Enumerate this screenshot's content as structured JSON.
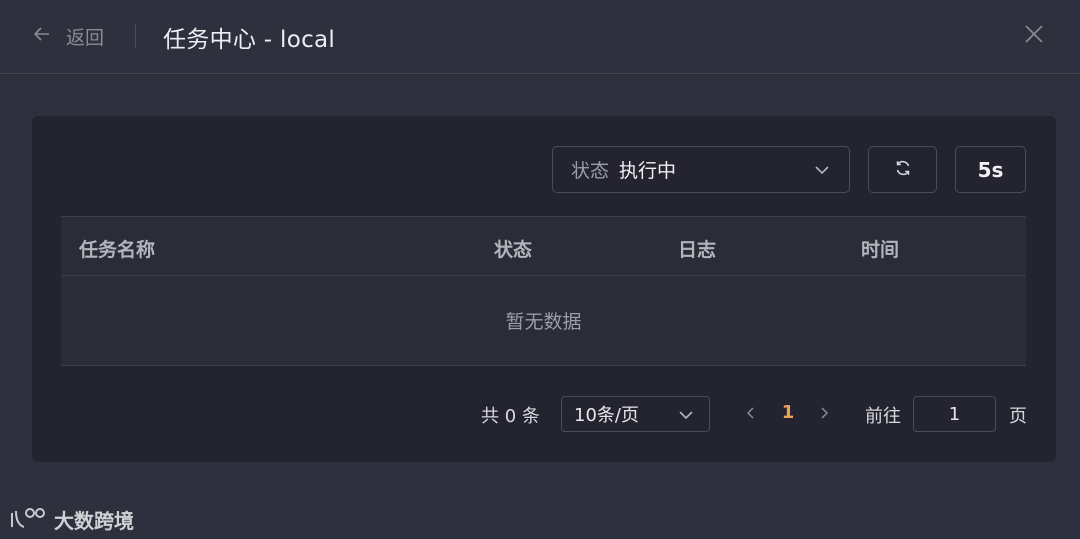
{
  "header": {
    "back_label": "返回",
    "title": "任务中心 - local"
  },
  "filters": {
    "status_prefix": "状态",
    "status_value": "执行中",
    "interval_label": "5s"
  },
  "table": {
    "columns": [
      "任务名称",
      "状态",
      "日志",
      "时间"
    ],
    "rows": [],
    "empty_text": "暂无数据"
  },
  "pagination": {
    "total_text": "共 0 条",
    "page_size": "10条/页",
    "current_page": "1",
    "goto_label": "前往",
    "goto_value": "1",
    "goto_suffix": "页"
  },
  "watermark": {
    "text": "大数跨境"
  },
  "icons": {
    "back": "arrow-left-icon",
    "close": "close-icon",
    "refresh": "refresh-icon",
    "dropdown": "chevron-down-icon",
    "prev": "chevron-left-icon",
    "next": "chevron-right-icon"
  },
  "colors": {
    "background": "#2f303d",
    "panel": "#23242f",
    "active_page": "#e8a25a"
  }
}
